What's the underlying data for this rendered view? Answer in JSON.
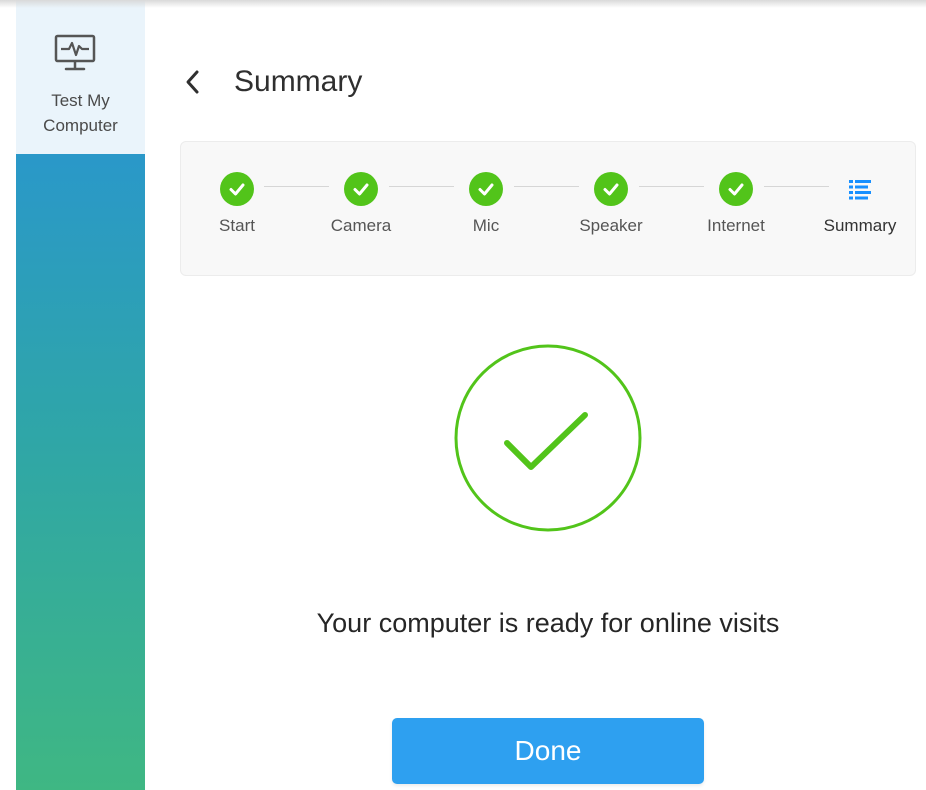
{
  "sidebar": {
    "items": [
      {
        "label": "Test My Computer",
        "icon": "monitor-heartbeat-icon",
        "active": true
      }
    ],
    "gradient_colors": [
      "#2a98c9",
      "#2fa6a7",
      "#3fb783"
    ]
  },
  "header": {
    "back_icon": "chevron-left-icon",
    "title": "Summary"
  },
  "stepper": {
    "steps": [
      {
        "label": "Start",
        "status": "complete",
        "icon": "check-circle-icon"
      },
      {
        "label": "Camera",
        "status": "complete",
        "icon": "check-circle-icon"
      },
      {
        "label": "Mic",
        "status": "complete",
        "icon": "check-circle-icon"
      },
      {
        "label": "Speaker",
        "status": "complete",
        "icon": "check-circle-icon"
      },
      {
        "label": "Internet",
        "status": "complete",
        "icon": "check-circle-icon"
      },
      {
        "label": "Summary",
        "status": "current",
        "icon": "list-icon"
      }
    ]
  },
  "result": {
    "icon": "large-checkmark-icon",
    "message": "Your computer is ready for online visits"
  },
  "actions": {
    "done_label": "Done"
  },
  "colors": {
    "success": "#52c41a",
    "accent": "#2ea0f0",
    "current_step": "#1890ff"
  }
}
